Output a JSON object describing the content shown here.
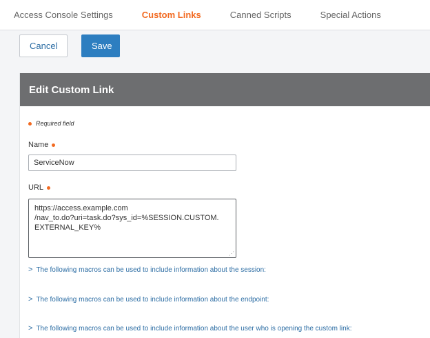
{
  "tabs": [
    {
      "label": "Access Console Settings",
      "active": false
    },
    {
      "label": "Custom Links",
      "active": true
    },
    {
      "label": "Canned Scripts",
      "active": false
    },
    {
      "label": "Special Actions",
      "active": false
    }
  ],
  "actions": {
    "cancel_label": "Cancel",
    "save_label": "Save"
  },
  "panel": {
    "title": "Edit Custom Link",
    "required_note": "Required field",
    "name_label": "Name",
    "name_value": "ServiceNow",
    "url_label": "URL",
    "url_value": "https://access.example.com\n/nav_to.do?uri=task.do?sys_id=%SESSION.CUSTOM.\nEXTERNAL_KEY%",
    "macro_links": [
      "The following macros can be used to include information about the session:",
      "The following macros can be used to include information about the endpoint:",
      "The following macros can be used to include information about the user who is opening the custom link:"
    ]
  },
  "colors": {
    "accent": "#f26a21",
    "primary": "#2d7ec0",
    "header_bg": "#6d6e70",
    "link": "#2b6ca3"
  }
}
